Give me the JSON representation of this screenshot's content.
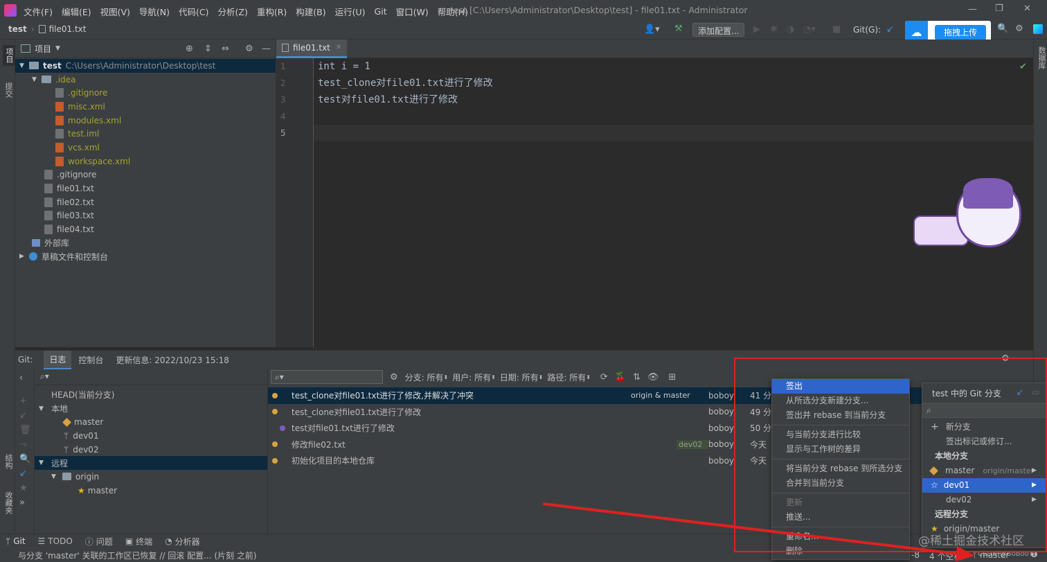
{
  "titlebar": {
    "menu": [
      "文件(F)",
      "编辑(E)",
      "视图(V)",
      "导航(N)",
      "代码(C)",
      "分析(Z)",
      "重构(R)",
      "构建(B)",
      "运行(U)",
      "Git",
      "窗口(W)",
      "帮助(H)"
    ],
    "window_title": "test [C:\\Users\\Administrator\\Desktop\\test] - file01.txt - Administrator"
  },
  "navbar": {
    "crumb_project": "test",
    "crumb_file": "file01.txt",
    "add_config": "添加配置...",
    "git_label": "Git(G):",
    "upload_label": "拖拽上传"
  },
  "left_stripe": {
    "project": "项目",
    "commit": "提交",
    "structure": "结构",
    "favorites": "收藏夹"
  },
  "right_stripe": {
    "database": "数据库"
  },
  "project_panel": {
    "title": "项目",
    "root_name": "test",
    "root_path": "C:\\Users\\Administrator\\Desktop\\test",
    "idea": ".idea",
    "idea_files": [
      ".gitignore",
      "misc.xml",
      "modules.xml",
      "test.iml",
      "vcs.xml",
      "workspace.xml"
    ],
    "files": [
      ".gitignore",
      "file01.txt",
      "file02.txt",
      "file03.txt",
      "file04.txt"
    ],
    "external": "外部库",
    "scratches": "草稿文件和控制台"
  },
  "editor": {
    "tab": "file01.txt",
    "line_numbers": [
      "1",
      "2",
      "3",
      "4",
      "5"
    ],
    "lines": [
      "int i = 1",
      "test_clone对file01.txt进行了修改",
      "test对file01.txt进行了修改",
      "",
      ""
    ]
  },
  "git_panel": {
    "label": "Git:",
    "tabs": [
      "日志",
      "控制台"
    ],
    "update_info": "更新信息: 2022/10/23 15:18",
    "head": "HEAD(当前分支)",
    "local": "本地",
    "local_branches": [
      "master",
      "dev01",
      "dev02"
    ],
    "remote": "远程",
    "origin": "origin",
    "remote_branches": [
      "master"
    ],
    "filters": {
      "branch": "分支: 所有",
      "user": "用户: 所有",
      "date": "日期: 所有",
      "path": "路径: 所有"
    },
    "commits": [
      {
        "msg": "test_clone对file01.txt进行了修改,并解决了冲突",
        "refs": "origin & master",
        "author": "boboy",
        "time": "41 分"
      },
      {
        "msg": "test_clone对file01.txt进行了修改",
        "refs": "",
        "author": "boboy",
        "time": "49 分"
      },
      {
        "msg": "test对file01.txt进行了修改",
        "refs": "",
        "author": "boboy",
        "time": "50 分"
      },
      {
        "msg": "修改file02.txt",
        "refs": "dev02",
        "author": "boboy",
        "time": "今天"
      },
      {
        "msg": "初始化项目的本地仓库",
        "refs": "",
        "author": "boboy",
        "time": "今天"
      }
    ]
  },
  "context_menu": {
    "items": [
      "签出",
      "从所选分支新建分支...",
      "签出并 rebase 到当前分支",
      "与当前分支进行比较",
      "显示与工作树的差异",
      "将当前分支 rebase 到所选分支",
      "合并到当前分支",
      "更新",
      "推送...",
      "重命名...",
      "删除"
    ]
  },
  "branch_popup": {
    "title": "test 中的 Git 分支",
    "new_branch": "新分支",
    "checkout_tag": "签出标记或修订...",
    "local_header": "本地分支",
    "local": [
      {
        "name": "master",
        "tracking": "origin/master"
      },
      {
        "name": "dev01",
        "tracking": ""
      },
      {
        "name": "dev02",
        "tracking": ""
      }
    ],
    "remote_header": "远程分支",
    "remote_item": "origin/master"
  },
  "bottom_tools": [
    "Git",
    "TODO",
    "问题",
    "终端",
    "分析器"
  ],
  "status": {
    "message": "与分支 'master' 关联的工作区已恢复 // 回滚  配置... (片刻 之前)",
    "encoding": "-8",
    "indent": "4 个空格",
    "branch": "master"
  },
  "watermark": "@稀土掘金技术社区",
  "watermark2": "CSDN @BoBooY",
  "colors": {
    "accent": "#2f65ca",
    "selection": "#0d293e",
    "highlight_red": "#e02020",
    "upload_blue": "#1c8cf2"
  }
}
